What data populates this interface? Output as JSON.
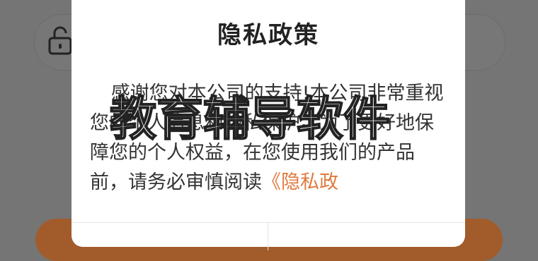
{
  "dialog": {
    "title": "隐私政策",
    "body_text": "感谢您对本公司的支持!本公司非常重视您的个人信息和隐私保护。为了更好地保障您的个人权益，在您使用我们的产品前，请务必审慎阅读",
    "link_text": "《隐私政"
  },
  "watermark": {
    "text": "教育辅导软件"
  },
  "icons": {
    "lock": "lock-open-icon"
  }
}
